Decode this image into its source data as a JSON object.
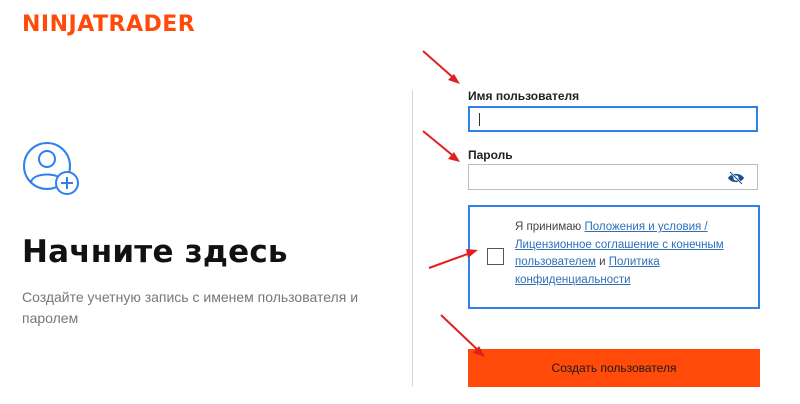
{
  "brand": {
    "logo_text": "NINJATRADER",
    "accent": "#ff4a0a"
  },
  "left": {
    "heading": "Начните здесь",
    "subtext": "Создайте учетную запись с именем пользователя и паролем",
    "avatar_icon": "add-user-icon"
  },
  "form": {
    "username_label": "Имя пользователя",
    "username_value": "",
    "password_label": "Пароль",
    "password_value": "",
    "password_icon": "eye-slash-icon",
    "terms": {
      "prefix": "Я принимаю ",
      "link1": "Положения и условия / Лицензионное соглашение с конечным пользователем",
      "conj": " и ",
      "link2": "Политика конфиденциальности",
      "checked": false
    },
    "submit_label": "Создать пользователя",
    "focus_color": "#2f80ed"
  },
  "annotation_color": "#e02020"
}
